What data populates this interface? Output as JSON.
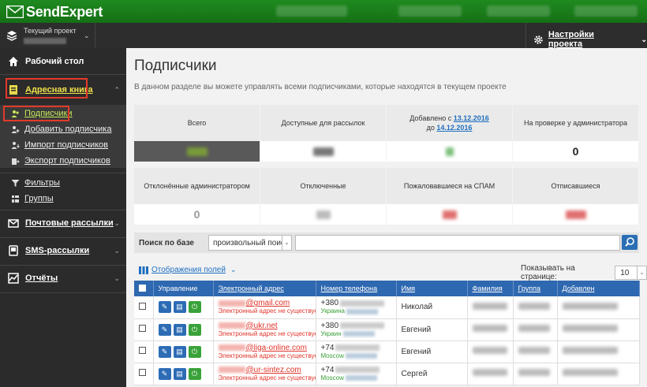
{
  "app": {
    "logo_text": "SendExpert"
  },
  "project": {
    "label": "Текущий проект",
    "settings_label": "Настройки проекта"
  },
  "sidebar": {
    "dashboard": "Рабочий стол",
    "address_book": "Адресная книга",
    "sub_items": [
      "Подписчики",
      "Добавить подписчика",
      "Импорт подписчиков",
      "Экспорт подписчиков"
    ],
    "filters": "Фильтры",
    "groups": "Группы",
    "mailings": "Почтовые рассылки",
    "sms": "SMS-рассылки",
    "reports": "Отчёты"
  },
  "page": {
    "title": "Подписчики",
    "description": "В данном разделе вы можете управлять всеми подписчиками, которые находятся в текущем проекте"
  },
  "stats": {
    "total": "Всего",
    "available": "Доступные для рассылок",
    "added_from_prefix": "Добавлено с",
    "added_from_date": "13.12.2016",
    "added_to_prefix": "до",
    "added_to_date": "14.12.2016",
    "admin_review": "На проверке у администратора",
    "admin_review_value": "0",
    "rejected": "Отклонённые администратором",
    "rejected_value": "0",
    "disabled": "Отключенные",
    "spam": "Пожаловавшиеся на СПАМ",
    "unsubscribed": "Отписавшиеся"
  },
  "search": {
    "label": "Поиск по базе",
    "select_value": "произвольный поиск"
  },
  "fields_toggle": "Отображения полей",
  "per_page": {
    "label": "Показывать на странице:",
    "value": "10"
  },
  "table": {
    "headers": [
      "Управление",
      "Электронный адрес",
      "Номер телефона",
      "Имя",
      "Фамилия",
      "Группа",
      "Добавлен"
    ],
    "rows": [
      {
        "email": "@gmail.com",
        "email_status": "Электронный адрес не существует",
        "phone": "+380",
        "region": "Украина",
        "name": "Николай"
      },
      {
        "email": "@ukr.net",
        "email_status": "Электронный адрес не существует",
        "phone": "+380",
        "region": "Украин",
        "name": "Евгений"
      },
      {
        "email": "@liga-online.com",
        "email_status": "Электронный адрес не существует",
        "phone": "+74",
        "region": "Moscow",
        "name": "Евгений"
      },
      {
        "email": "@ur-sintez.com",
        "email_status": "Электронный адрес не существует",
        "phone": "+74",
        "region": "Moscow",
        "name": "Сергей"
      }
    ]
  },
  "colors": {
    "green": "#1f8a1f",
    "blue": "#2e68b0",
    "red": "#e0342a",
    "sidebar": "#2b2b2b"
  }
}
